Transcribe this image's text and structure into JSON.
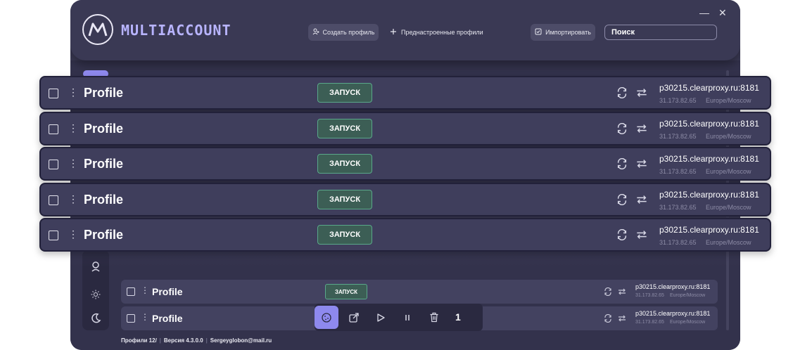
{
  "app": {
    "logo_text": "MULTIACCOUNT",
    "buttons": {
      "create_profile": "Создать профиль",
      "preset_profiles": "Преднастроенные профили",
      "import": "Импортировать"
    },
    "search": {
      "value": "",
      "placeholder": "Поиск"
    },
    "window_controls": {
      "minimize": "—",
      "close": "✕"
    }
  },
  "sidebar": {
    "icons": [
      "user-icon",
      "sun-icon",
      "moon-icon"
    ]
  },
  "profiles_expanded": [
    {
      "name": "Profile",
      "run_label": "ЗАПУСК",
      "proxy": "p30215.clearproxy.ru:8181",
      "ip": "31.173.82.65",
      "timezone": "Europe/Moscow"
    },
    {
      "name": "Profile",
      "run_label": "ЗАПУСК",
      "proxy": "p30215.clearproxy.ru:8181",
      "ip": "31.173.82.65",
      "timezone": "Europe/Moscow"
    },
    {
      "name": "Profile",
      "run_label": "ЗАПУСК",
      "proxy": "p30215.clearproxy.ru:8181",
      "ip": "31.173.82.65",
      "timezone": "Europe/Moscow"
    },
    {
      "name": "Profile",
      "run_label": "ЗАПУСК",
      "proxy": "p30215.clearproxy.ru:8181",
      "ip": "31.173.82.65",
      "timezone": "Europe/Moscow"
    },
    {
      "name": "Profile",
      "run_label": "ЗАПУСК",
      "proxy": "p30215.clearproxy.ru:8181",
      "ip": "31.173.82.65",
      "timezone": "Europe/Moscow"
    }
  ],
  "profiles_list": [
    {
      "name": "Profile",
      "run_label": "ЗАПУСК",
      "proxy": "p30215.clearproxy.ru:8181",
      "ip": "31.173.82.65",
      "timezone": "Europe/Moscow"
    },
    {
      "name": "Profile",
      "proxy": "p30215.clearproxy.ru:8181",
      "ip": "31.173.82.65",
      "timezone": "Europe/Moscow"
    }
  ],
  "toolbar": {
    "selected_count": "1",
    "icons": [
      "cookie-icon",
      "external-link-icon",
      "play-icon",
      "pause-icon",
      "trash-icon"
    ]
  },
  "footer": {
    "profiles": "Профили 12/",
    "version": "Версия 4.3.0.0",
    "email": "Sergeyglobon@mail.ru"
  },
  "colors": {
    "background": "#3b3a55",
    "accent": "#8e89ee",
    "run_button": "#3c5e55",
    "run_border": "#5aa88a",
    "logo_text": "#b8b4ff"
  }
}
